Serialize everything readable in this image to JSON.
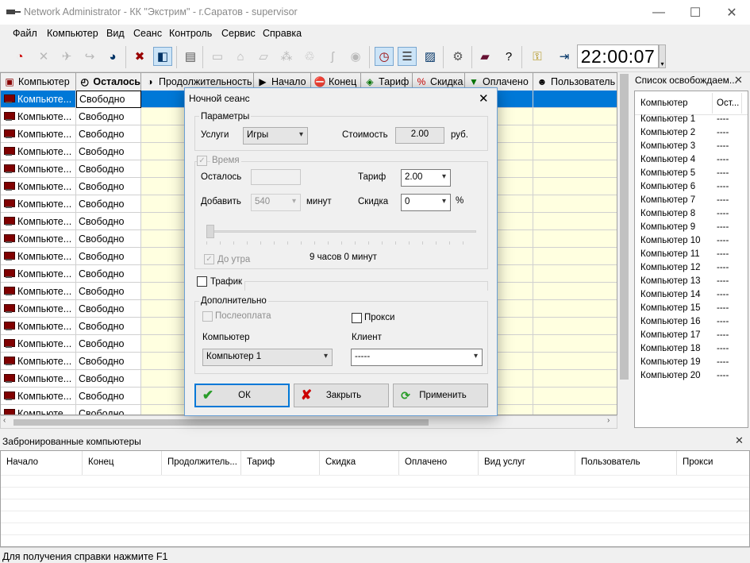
{
  "window": {
    "title": "Network Administrator - КК \"Экстрим\" - г.Саратов - supervisor",
    "minimize": "—",
    "maximize": "☐",
    "close": "✕"
  },
  "menu": [
    "Файл",
    "Компьютер",
    "Вид",
    "Сеанс",
    "Контроль",
    "Сервис",
    "Справка"
  ],
  "clock": "22:00:07",
  "grid": {
    "columns": [
      "Компьютер",
      "Осталось",
      "Продолжительность",
      "Начало",
      "Конец",
      "Тариф",
      "Скидка",
      "Оплачено",
      "Пользователь"
    ],
    "rows": [
      {
        "computer": "Компьюте...",
        "remaining": "Свободно"
      },
      {
        "computer": "Компьюте...",
        "remaining": "Свободно"
      },
      {
        "computer": "Компьюте...",
        "remaining": "Свободно"
      },
      {
        "computer": "Компьюте...",
        "remaining": "Свободно"
      },
      {
        "computer": "Компьюте...",
        "remaining": "Свободно"
      },
      {
        "computer": "Компьюте...",
        "remaining": "Свободно"
      },
      {
        "computer": "Компьюте...",
        "remaining": "Свободно"
      },
      {
        "computer": "Компьюте...",
        "remaining": "Свободно"
      },
      {
        "computer": "Компьюте...",
        "remaining": "Свободно"
      },
      {
        "computer": "Компьюте...",
        "remaining": "Свободно"
      },
      {
        "computer": "Компьюте...",
        "remaining": "Свободно"
      },
      {
        "computer": "Компьюте...",
        "remaining": "Свободно"
      },
      {
        "computer": "Компьюте...",
        "remaining": "Свободно"
      },
      {
        "computer": "Компьюте...",
        "remaining": "Свободно"
      },
      {
        "computer": "Компьюте...",
        "remaining": "Свободно"
      },
      {
        "computer": "Компьюте...",
        "remaining": "Свободно"
      },
      {
        "computer": "Компьюте...",
        "remaining": "Свободно"
      },
      {
        "computer": "Компьюте...",
        "remaining": "Свободно"
      },
      {
        "computer": "Компьюте...",
        "remaining": "Свободно"
      }
    ]
  },
  "free_list": {
    "title": "Список освобождаем...",
    "headers": [
      "Компьютер",
      "Ост..."
    ],
    "rows": [
      [
        "Компьютер 1",
        "----"
      ],
      [
        "Компьютер 2",
        "----"
      ],
      [
        "Компьютер 3",
        "----"
      ],
      [
        "Компьютер 4",
        "----"
      ],
      [
        "Компьютер 5",
        "----"
      ],
      [
        "Компьютер 6",
        "----"
      ],
      [
        "Компьютер 7",
        "----"
      ],
      [
        "Компьютер 8",
        "----"
      ],
      [
        "Компьютер 9",
        "----"
      ],
      [
        "Компьютер 10",
        "----"
      ],
      [
        "Компьютер 11",
        "----"
      ],
      [
        "Компьютер 12",
        "----"
      ],
      [
        "Компьютер 13",
        "----"
      ],
      [
        "Компьютер 14",
        "----"
      ],
      [
        "Компьютер 15",
        "----"
      ],
      [
        "Компьютер 16",
        "----"
      ],
      [
        "Компьютер 17",
        "----"
      ],
      [
        "Компьютер 18",
        "----"
      ],
      [
        "Компьютер 19",
        "----"
      ],
      [
        "Компьютер 20",
        "----"
      ]
    ]
  },
  "reserved": {
    "title": "Забронированные компьютеры",
    "columns": [
      "Начало",
      "Конец",
      "Продолжитель...",
      "Тариф",
      "Скидка",
      "Оплачено",
      "Вид услуг",
      "Пользователь",
      "Прокси"
    ]
  },
  "status": "Для получения справки нажмите F1",
  "dialog": {
    "title": "Ночной сеанс",
    "params_label": "Параметры",
    "services_label": "Услуги",
    "services_value": "Игры",
    "cost_label": "Стоимость",
    "cost_value": "2.00",
    "cost_unit": "руб.",
    "time_label": "Время",
    "remaining_label": "Осталось",
    "remaining_value": "",
    "tariff_label": "Тариф",
    "tariff_value": "2.00",
    "add_label": "Добавить",
    "add_value": "540",
    "minutes_label": "минут",
    "discount_label": "Скидка",
    "discount_value": "0",
    "percent": "%",
    "until_morning_label": "До утра",
    "duration_text": "9 часов 0 минут",
    "traffic_label": "Трафик",
    "additional_label": "Дополнительно",
    "postpay_label": "Послеоплата",
    "proxy_label": "Прокси",
    "computer_label": "Компьютер",
    "computer_value": "Компьютер 1",
    "client_label": "Клиент",
    "client_value": "-----",
    "ok_label": "ОК",
    "close_label": "Закрыть",
    "apply_label": "Применить"
  }
}
